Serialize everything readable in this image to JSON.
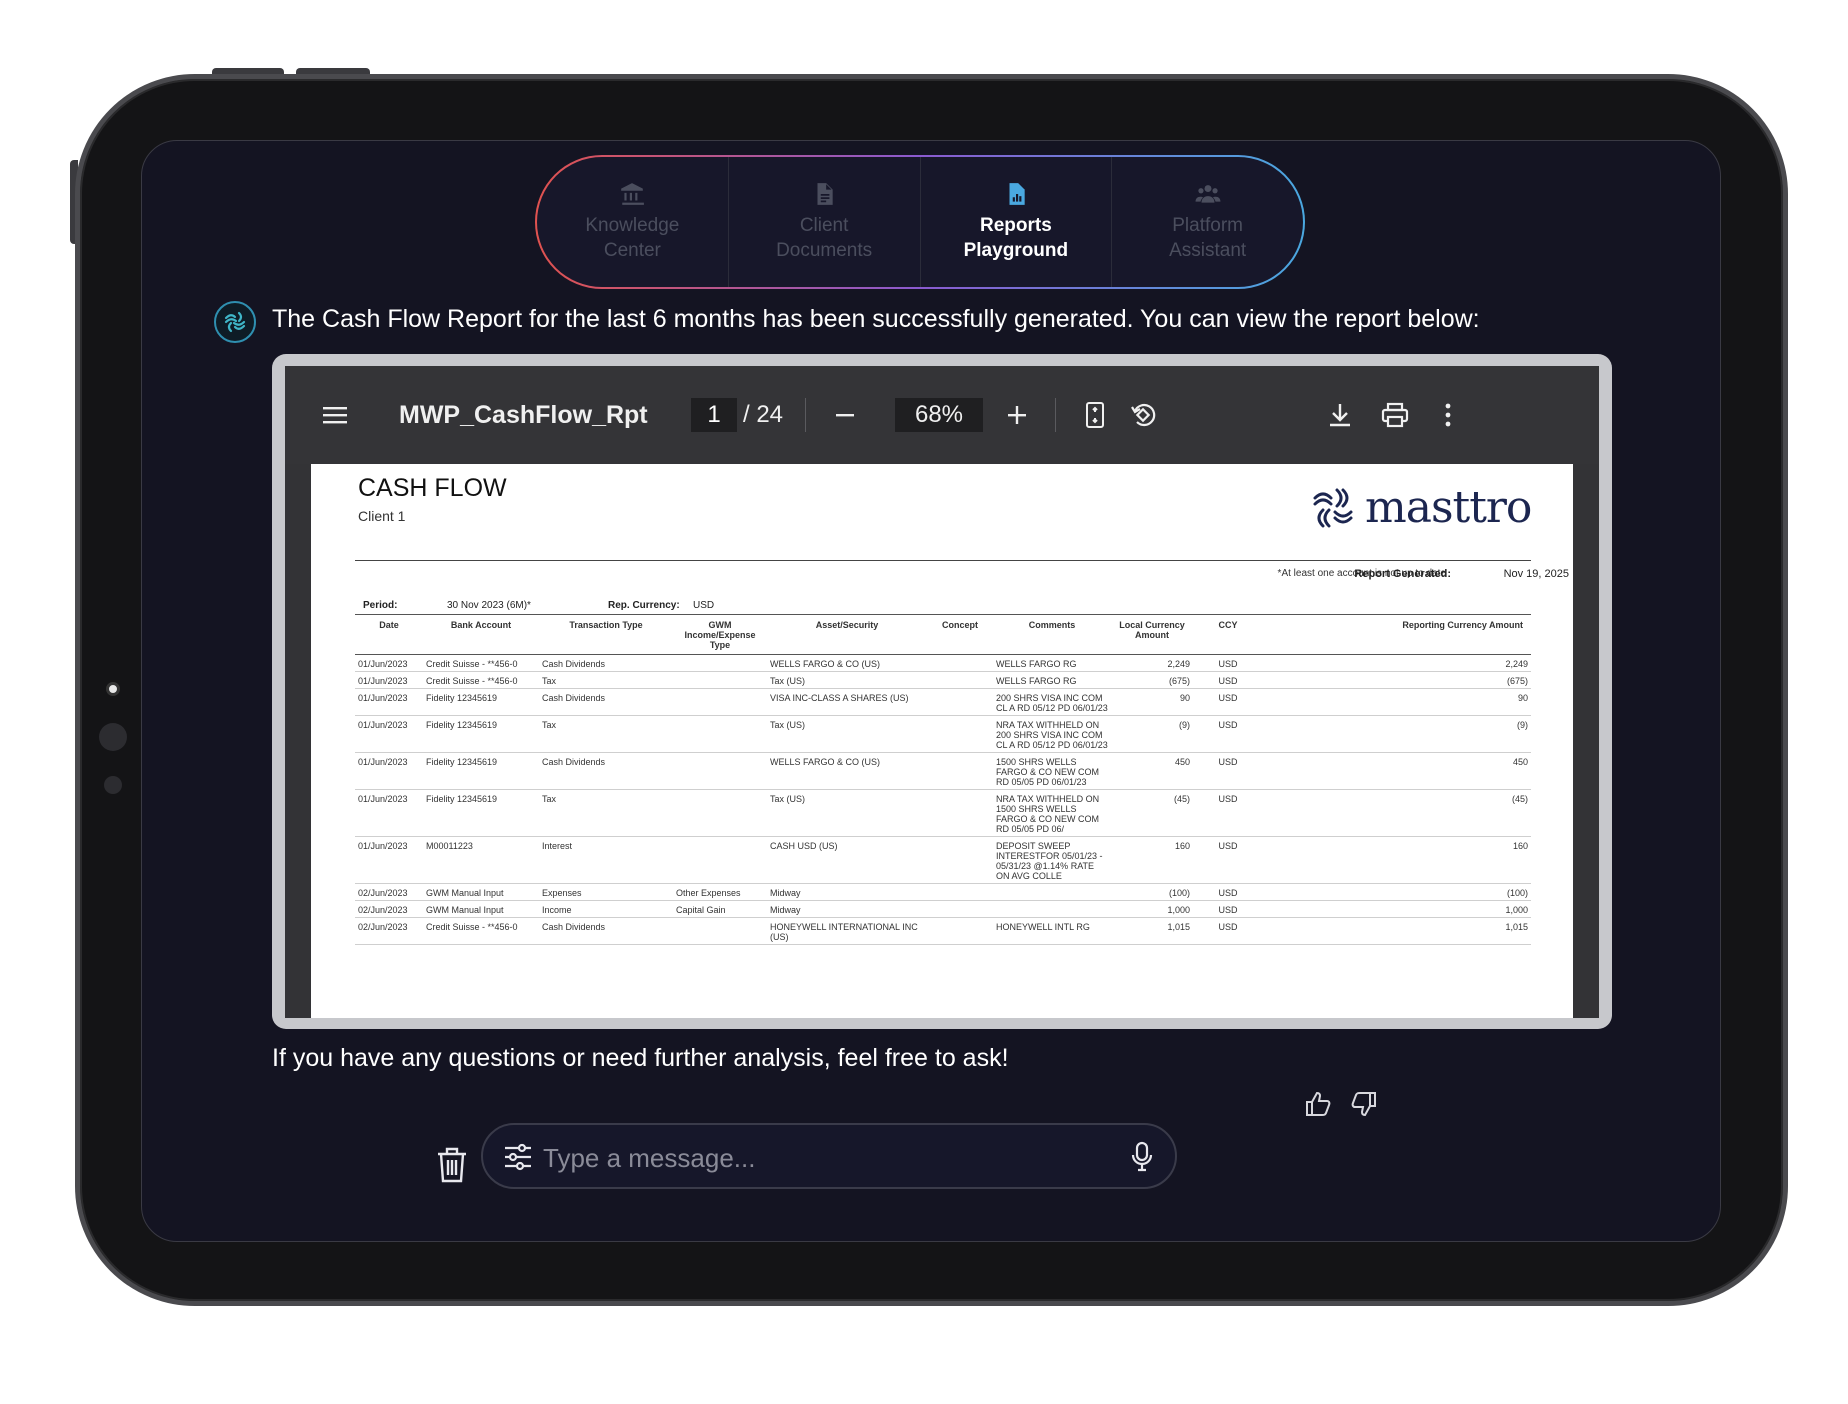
{
  "nav": {
    "items": [
      {
        "line1": "Knowledge",
        "line2": "Center"
      },
      {
        "line1": "Client",
        "line2": "Documents"
      },
      {
        "line1": "Reports",
        "line2": "Playground"
      },
      {
        "line1": "Platform",
        "line2": "Assistant"
      }
    ]
  },
  "chat": {
    "message_intro": "The Cash Flow Report for the last 6 months has been successfully generated. You can view the report below:",
    "message_outro": "If you have any questions or need further analysis, feel free to ask!",
    "input_placeholder": "Type a message..."
  },
  "viewer": {
    "file_name": "MWP_CashFlow_Rpt",
    "current_page": "1",
    "total_pages": "/ 24",
    "zoom": "68%"
  },
  "report": {
    "title": "CASH FLOW",
    "client": "Client 1",
    "logo_text": "masttro",
    "note": "*At least one account is not up to date",
    "generated_label": "Report Generated:",
    "generated_value": "Nov 19, 2025",
    "period_label": "Period:",
    "period_value": "30 Nov 2023 (6M)*",
    "currency_label": "Rep. Currency:",
    "currency_value": "USD",
    "columns": [
      "Date",
      "Bank Account",
      "Transaction Type",
      "GWM Income/Expense Type",
      "Asset/Security",
      "Concept",
      "Comments",
      "Local Currency Amount",
      "CCY",
      "Reporting Currency Amount"
    ],
    "rows": [
      [
        "01/Jun/2023",
        "Credit Suisse - **456-0",
        "Cash Dividends",
        "",
        "WELLS FARGO & CO (US)",
        "",
        "WELLS FARGO RG",
        "2,249",
        "USD",
        "2,249"
      ],
      [
        "01/Jun/2023",
        "Credit Suisse - **456-0",
        "Tax",
        "",
        "Tax (US)",
        "",
        "WELLS FARGO RG",
        "(675)",
        "USD",
        "(675)"
      ],
      [
        "01/Jun/2023",
        "Fidelity 12345619",
        "Cash Dividends",
        "",
        "VISA INC-CLASS A SHARES (US)",
        "",
        "200 SHRS VISA INC COM CL A RD 05/12 PD 06/01/23",
        "90",
        "USD",
        "90"
      ],
      [
        "01/Jun/2023",
        "Fidelity 12345619",
        "Tax",
        "",
        "Tax (US)",
        "",
        "NRA TAX WITHHELD ON 200 SHRS VISA INC COM CL A RD 05/12 PD 06/01/23",
        "(9)",
        "USD",
        "(9)"
      ],
      [
        "01/Jun/2023",
        "Fidelity 12345619",
        "Cash Dividends",
        "",
        "WELLS FARGO & CO (US)",
        "",
        "1500 SHRS WELLS FARGO & CO NEW COM RD 05/05 PD 06/01/23",
        "450",
        "USD",
        "450"
      ],
      [
        "01/Jun/2023",
        "Fidelity 12345619",
        "Tax",
        "",
        "Tax (US)",
        "",
        "NRA TAX WITHHELD ON 1500 SHRS WELLS FARGO & CO NEW COM RD 05/05 PD 06/",
        "(45)",
        "USD",
        "(45)"
      ],
      [
        "01/Jun/2023",
        "M00011223",
        "Interest",
        "",
        "CASH USD (US)",
        "",
        "DEPOSIT SWEEP INTERESTFOR 05/01/23 - 05/31/23 @1.14% RATE ON AVG COLLE",
        "160",
        "USD",
        "160"
      ],
      [
        "02/Jun/2023",
        "GWM Manual Input",
        "Expenses",
        "Other Expenses",
        "Midway",
        "",
        "",
        "(100)",
        "USD",
        "(100)"
      ],
      [
        "02/Jun/2023",
        "GWM Manual Input",
        "Income",
        "Capital Gain",
        "Midway",
        "",
        "",
        "1,000",
        "USD",
        "1,000"
      ],
      [
        "02/Jun/2023",
        "Credit Suisse - **456-0",
        "Cash Dividends",
        "",
        "HONEYWELL INTERNATIONAL INC (US)",
        "",
        "HONEYWELL INTL RG",
        "1,015",
        "USD",
        "1,015"
      ]
    ]
  },
  "colors": {
    "screen_bg": "#141422",
    "accent_gradient_start": "#e0524f",
    "accent_gradient_end": "#4aa8e0",
    "icon_active": "#4aa8e0",
    "logo_navy": "#1c2650"
  },
  "icons": [
    "bank-icon",
    "document-icon",
    "report-chart-icon",
    "people-icon",
    "menu-icon",
    "minus-icon",
    "plus-icon",
    "fit-page-icon",
    "rotate-icon",
    "download-icon",
    "print-icon",
    "more-vertical-icon",
    "trash-icon",
    "sliders-icon",
    "microphone-icon",
    "thumbs-up-icon",
    "thumbs-down-icon"
  ]
}
